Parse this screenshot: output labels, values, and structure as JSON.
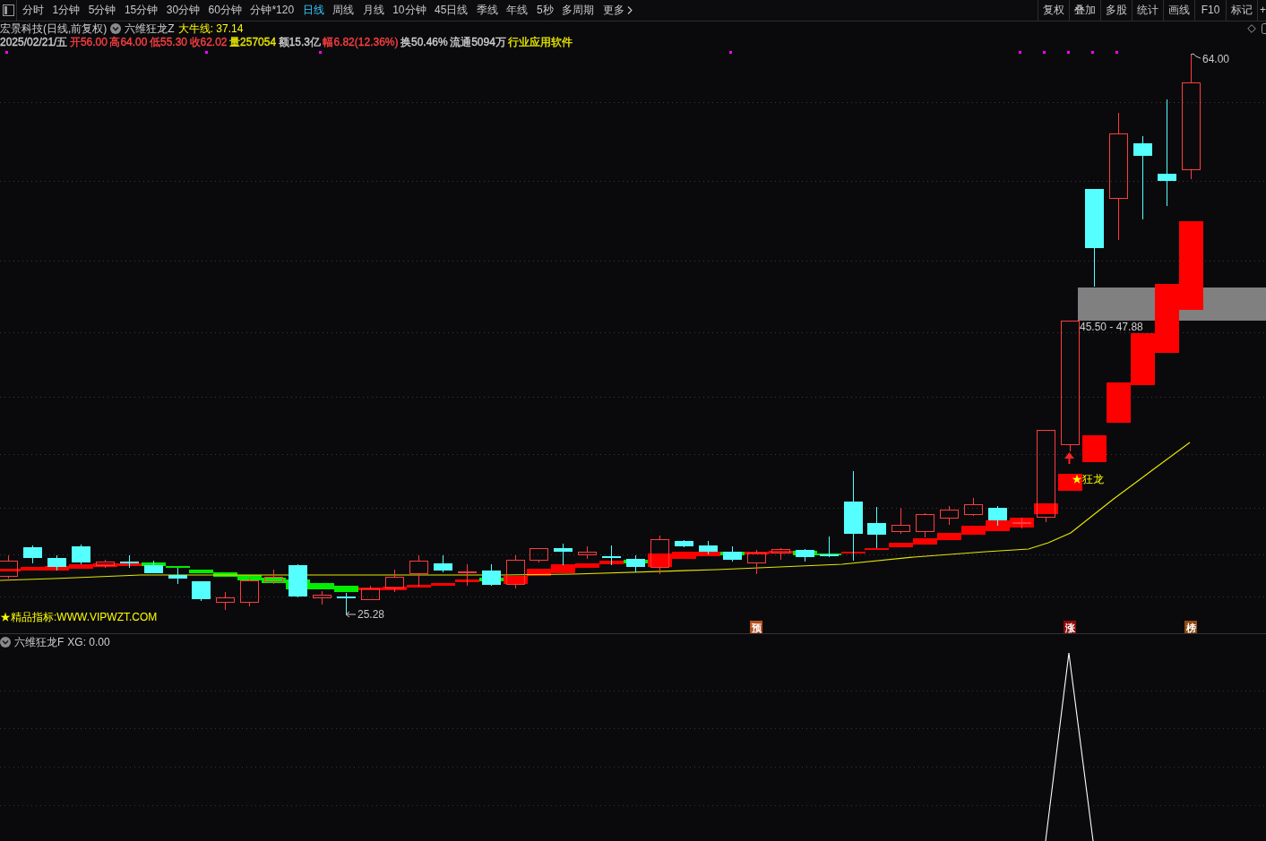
{
  "toolbar": {
    "periods": [
      {
        "label": "分时",
        "kind": "period",
        "selected": false
      },
      {
        "label": "1分钟",
        "kind": "period",
        "selected": false
      },
      {
        "label": "5分钟",
        "kind": "period",
        "selected": false
      },
      {
        "label": "15分钟",
        "kind": "period",
        "selected": false
      },
      {
        "label": "30分钟",
        "kind": "period",
        "selected": false
      },
      {
        "label": "60分钟",
        "kind": "period",
        "selected": false
      },
      {
        "label": "分钟*120",
        "kind": "period",
        "selected": false
      },
      {
        "label": "日线",
        "kind": "period",
        "selected": true
      },
      {
        "label": "周线",
        "kind": "period",
        "selected": false
      },
      {
        "label": "月线",
        "kind": "period",
        "selected": false
      },
      {
        "label": "10分钟",
        "kind": "period",
        "selected": false
      },
      {
        "label": "45日线",
        "kind": "period",
        "selected": false
      },
      {
        "label": "季线",
        "kind": "period",
        "selected": false
      },
      {
        "label": "年线",
        "kind": "period",
        "selected": false
      },
      {
        "label": "5秒",
        "kind": "period",
        "selected": false
      },
      {
        "label": "多周期",
        "kind": "period",
        "selected": false
      },
      {
        "label": "更多",
        "kind": "menu",
        "selected": false
      }
    ],
    "tools": [
      "复权",
      "叠加",
      "多股",
      "统计",
      "画线",
      "F10",
      "标记",
      "+"
    ]
  },
  "header": {
    "title": "宏景科技(日线,前复权)",
    "indicator": "六维狂龙Z",
    "reading": "大牛线: 37.14"
  },
  "quote": [
    {
      "text": "2025/02/21/五",
      "color": "#d0d0d0"
    },
    {
      "text": "开56.00",
      "color": "#ff4040"
    },
    {
      "text": "高64.00",
      "color": "#ff4040"
    },
    {
      "text": "低55.30",
      "color": "#ff4040"
    },
    {
      "text": "收62.02",
      "color": "#ff4040"
    },
    {
      "text": "量257054",
      "color": "#e6e600"
    },
    {
      "text": "额15.3亿",
      "color": "#d0d0d0"
    },
    {
      "text": "幅6.82(12.36%)",
      "color": "#ff4040"
    },
    {
      "text": "换50.46%",
      "color": "#d0d0d0"
    },
    {
      "text": "流通5094万",
      "color": "#d0d0d0"
    },
    {
      "text": "行业应用软件",
      "color": "#e6e600"
    }
  ],
  "chart": {
    "high_label": "64.00",
    "low_label": "25.28",
    "zone_label": "45.50 - 47.88",
    "signal_label": "★狂龙",
    "promo_text": "★精品指标:WWW.VIPWZT.COM",
    "markers": [
      {
        "label": "预",
        "color": "#b4501e"
      },
      {
        "label": "涨",
        "color": "#8c0a0a"
      },
      {
        "label": "榜",
        "color": "#8c4a14"
      }
    ]
  },
  "lower_panel": {
    "indicator": "六维狂龙F",
    "reading": "XG: 0.00"
  }
}
